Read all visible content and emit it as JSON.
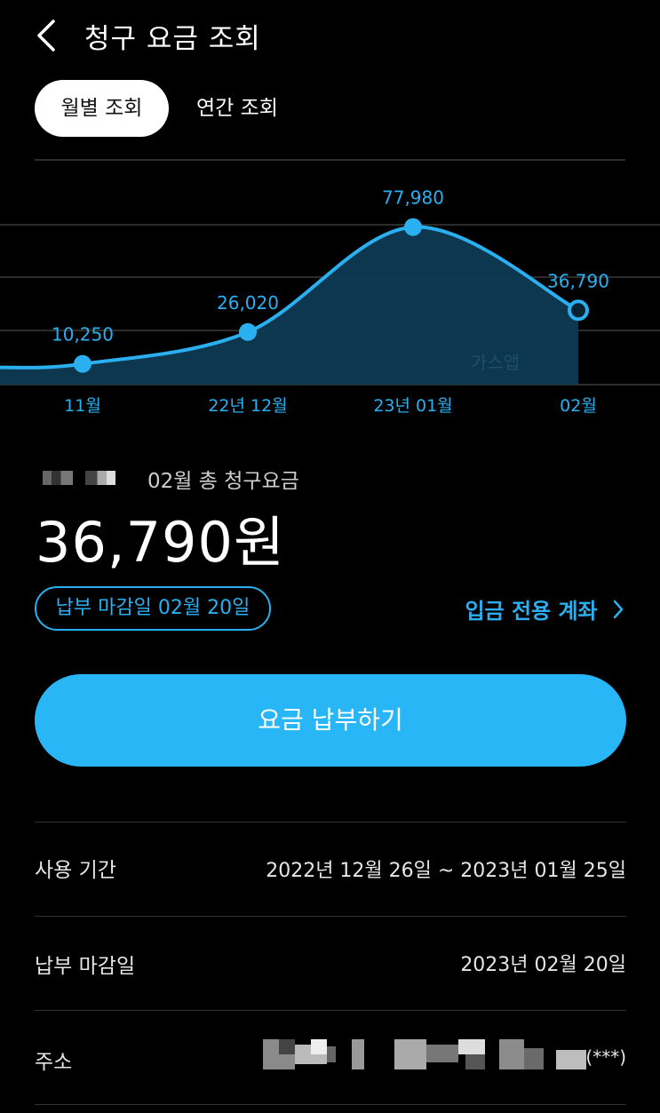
{
  "header": {
    "title": "청구 요금 조회"
  },
  "tabs": [
    {
      "label": "월별 조회",
      "active": true
    },
    {
      "label": "연간 조회",
      "active": false
    }
  ],
  "chart_data": {
    "type": "area",
    "categories": [
      "11월",
      "22년 12월",
      "23년 01월",
      "02월"
    ],
    "values": [
      10250,
      26020,
      77980,
      36790
    ],
    "value_labels": [
      "10,250",
      "26,020",
      "77,980",
      "36,790"
    ],
    "selected_index": 3,
    "watermark": "가스앱",
    "colors": {
      "line": "#2ab0f0",
      "fill": "#0e3a52"
    }
  },
  "summary": {
    "total_label": "02월 총 청구요금",
    "amount": "36,790원"
  },
  "due_pill": "납부 마감일 02월 20일",
  "account_link": "입금 전용 계좌",
  "pay_button": "요금 납부하기",
  "details": [
    {
      "label": "사용 기간",
      "value": "2022년 12월 26일 ~ 2023년 01월 25일"
    },
    {
      "label": "납부 마감일",
      "value": "2023년 02월 20일"
    },
    {
      "label": "주소",
      "value": "(***)"
    }
  ],
  "colors": {
    "accent": "#29b6f6",
    "background": "#000000"
  }
}
